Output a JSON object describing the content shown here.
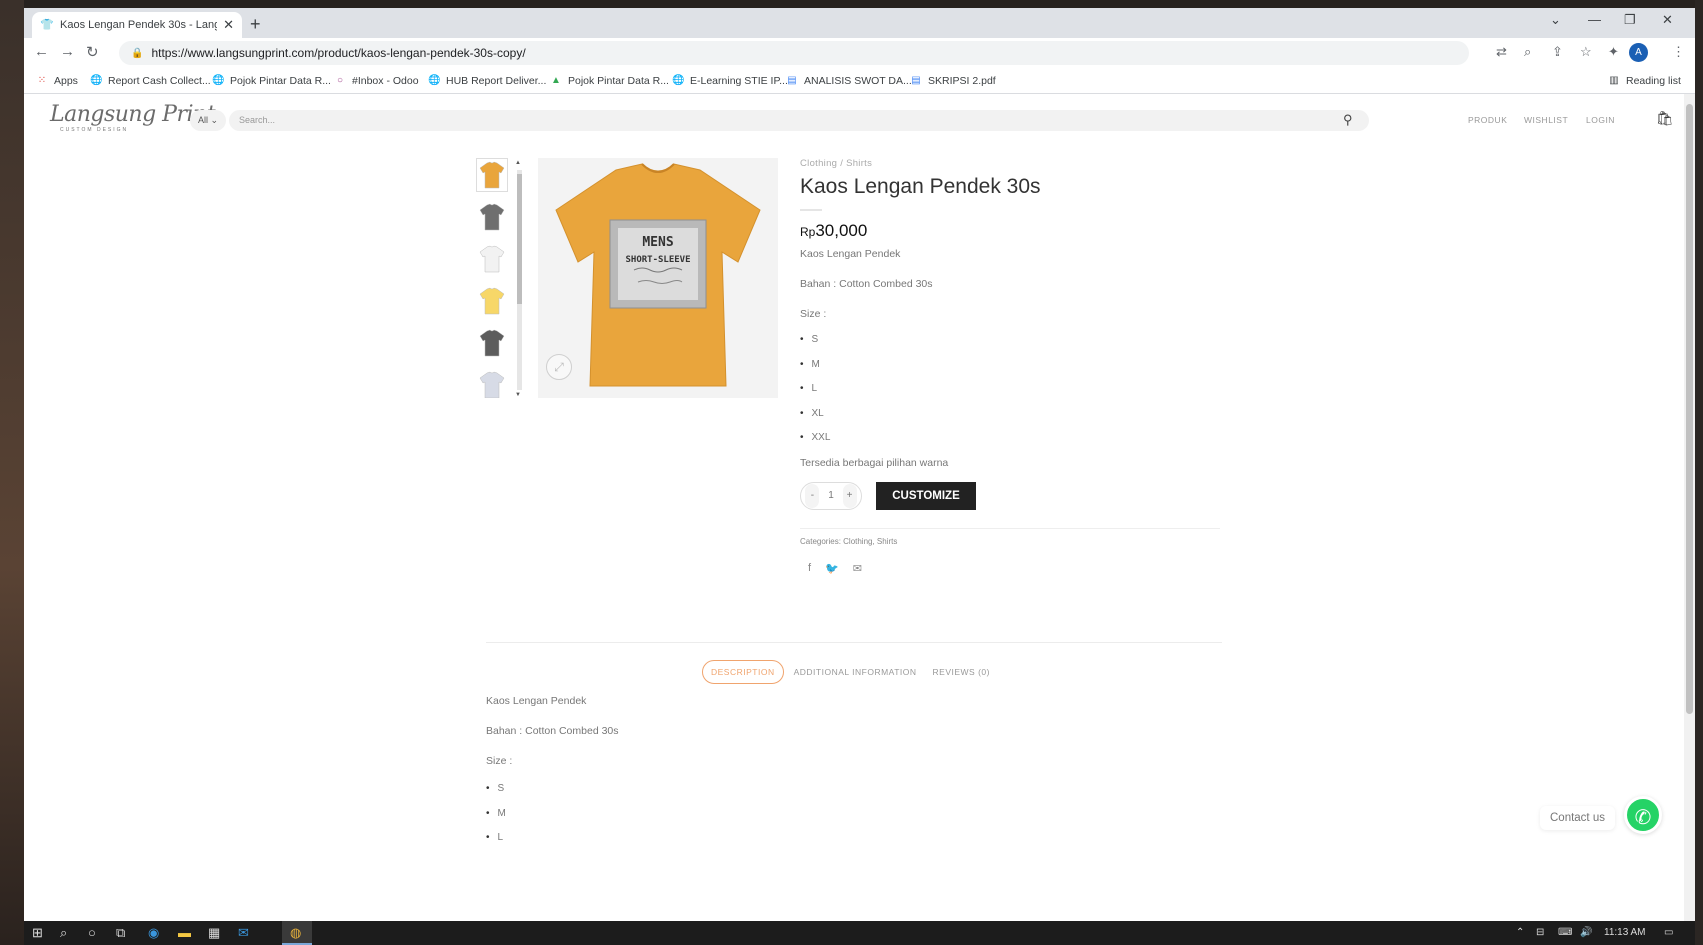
{
  "browser": {
    "tab_title": "Kaos Lengan Pendek 30s - Lang...",
    "url": "https://www.langsungprint.com/product/kaos-lengan-pendek-30s-copy/",
    "avatar_letter": "A",
    "bookmarks": [
      {
        "label": "Apps",
        "icon": "apps-grid-icon"
      },
      {
        "label": "Report Cash Collect...",
        "icon": "globe-icon"
      },
      {
        "label": "Pojok Pintar Data R...",
        "icon": "globe-icon"
      },
      {
        "label": "#Inbox - Odoo",
        "icon": "odoo-icon"
      },
      {
        "label": "HUB Report Deliver...",
        "icon": "globe-icon"
      },
      {
        "label": "Pojok Pintar Data R...",
        "icon": "drive-icon"
      },
      {
        "label": "E-Learning STIE IP...",
        "icon": "globe-icon"
      },
      {
        "label": "ANALISIS SWOT DA...",
        "icon": "doc-icon"
      },
      {
        "label": "SKRIPSI 2.pdf",
        "icon": "doc-icon"
      }
    ],
    "reading_list": "Reading list"
  },
  "site": {
    "logo_text": "Langsung Print",
    "logo_sub": "CUSTOM DESIGN",
    "category_select": "All",
    "search_placeholder": "Search...",
    "nav": [
      "PRODUK",
      "WISHLIST",
      "LOGIN"
    ]
  },
  "product": {
    "breadcrumb": "Clothing  /  Shirts",
    "title": "Kaos Lengan Pendek 30s",
    "currency": "Rp",
    "price": "30,000",
    "short_desc": "Kaos Lengan Pendek",
    "material": "Bahan : Cotton Combed 30s",
    "size_label": "Size :",
    "sizes": [
      "S",
      "M",
      "L",
      "XL",
      "XXL"
    ],
    "colors_note": "Tersedia berbagai pilihan warna",
    "qty_minus": "-",
    "quantity": "1",
    "qty_plus": "+",
    "customize_label": "CUSTOMIZE",
    "categories": "Categories: Clothing, Shirts",
    "mockup_text": [
      "MENS",
      "SHORT-SLEEVE"
    ],
    "thumbnail_colors": [
      "#e9a53c",
      "#6f6f6f",
      "#f2f2f2",
      "#f7d768",
      "#5d5d5d",
      "#d7dbe6"
    ],
    "main_color": "#e9a53c"
  },
  "tabs": {
    "items": [
      "DESCRIPTION",
      "ADDITIONAL INFORMATION",
      "REVIEWS (0)"
    ],
    "active": "DESCRIPTION",
    "panel": {
      "short_desc": "Kaos Lengan Pendek",
      "material": "Bahan : Cotton Combed 30s",
      "size_label": "Size :",
      "sizes": [
        "S",
        "M",
        "L"
      ]
    }
  },
  "contact": {
    "label": "Contact us"
  },
  "taskbar": {
    "time": "11:13 AM"
  }
}
